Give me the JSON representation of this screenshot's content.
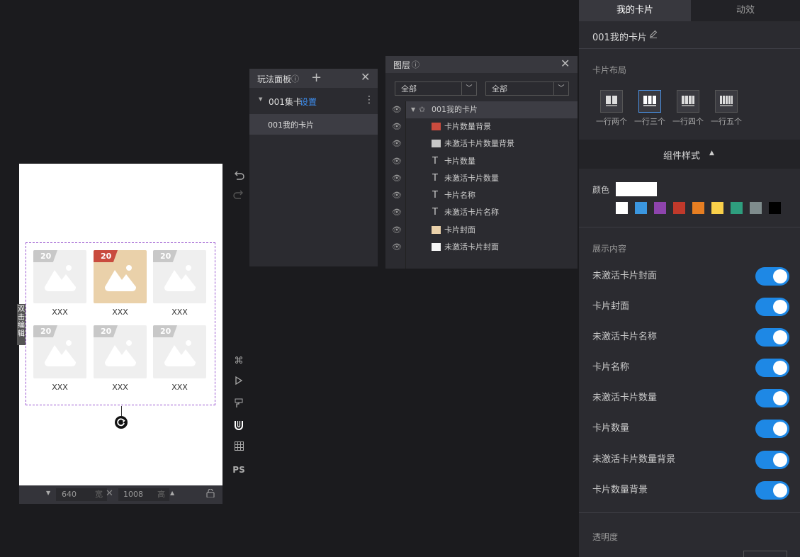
{
  "canvas": {
    "cards": [
      {
        "badge": "20",
        "label": "XXX",
        "active": false
      },
      {
        "badge": "20",
        "label": "XXX",
        "active": true
      },
      {
        "badge": "20",
        "label": "XXX",
        "active": false
      },
      {
        "badge": "20",
        "label": "XXX",
        "active": false
      },
      {
        "badge": "20",
        "label": "XXX",
        "active": false
      },
      {
        "badge": "20",
        "label": "XXX",
        "active": false
      }
    ],
    "edit_hint": "双击编辑",
    "width": "640",
    "width_unit": "宽",
    "height": "1008",
    "height_unit": "高",
    "ps_label": "PS"
  },
  "play_panel": {
    "title": "玩法面板",
    "group_name": "001集卡",
    "group_link": "设置",
    "item": "001我的卡片"
  },
  "layers_panel": {
    "title": "图层",
    "filter1": "全部",
    "filter2": "全部",
    "root": "001我的卡片",
    "items": [
      {
        "name": "卡片数量背景",
        "icon": "red-rect-icon"
      },
      {
        "name": "未激活卡片数量背景",
        "icon": "gray-rect-icon"
      },
      {
        "name": "卡片数量",
        "icon": "text-icon"
      },
      {
        "name": "未激活卡片数量",
        "icon": "text-icon"
      },
      {
        "name": "卡片名称",
        "icon": "text-icon"
      },
      {
        "name": "未激活卡片名称",
        "icon": "text-icon"
      },
      {
        "name": "卡片封面",
        "icon": "image-icon"
      },
      {
        "name": "未激活卡片封面",
        "icon": "white-rect-icon"
      }
    ]
  },
  "right_panel": {
    "tab_active": "我的卡片",
    "tab_other": "动效",
    "component_name": "001我的卡片",
    "layout_title": "卡片布局",
    "layouts": [
      "一行两个",
      "一行三个",
      "一行四个",
      "一行五个"
    ],
    "style_title": "组件样式",
    "color_label": "颜色",
    "swatches": [
      "#ffffff",
      "#3b97e0",
      "#8e44ad",
      "#c0392b",
      "#e67e22",
      "#f9d04a",
      "#2e9e7e",
      "#7f8c8d",
      "#000000"
    ],
    "display_title": "展示内容",
    "toggles": [
      {
        "label": "未激活卡片封面",
        "on": true
      },
      {
        "label": "卡片封面",
        "on": true
      },
      {
        "label": "未激活卡片名称",
        "on": true
      },
      {
        "label": "卡片名称",
        "on": true
      },
      {
        "label": "未激活卡片数量",
        "on": true
      },
      {
        "label": "卡片数量",
        "on": true
      },
      {
        "label": "未激活卡片数量背景",
        "on": true
      },
      {
        "label": "卡片数量背景",
        "on": true
      }
    ],
    "opacity_title": "透明度"
  }
}
